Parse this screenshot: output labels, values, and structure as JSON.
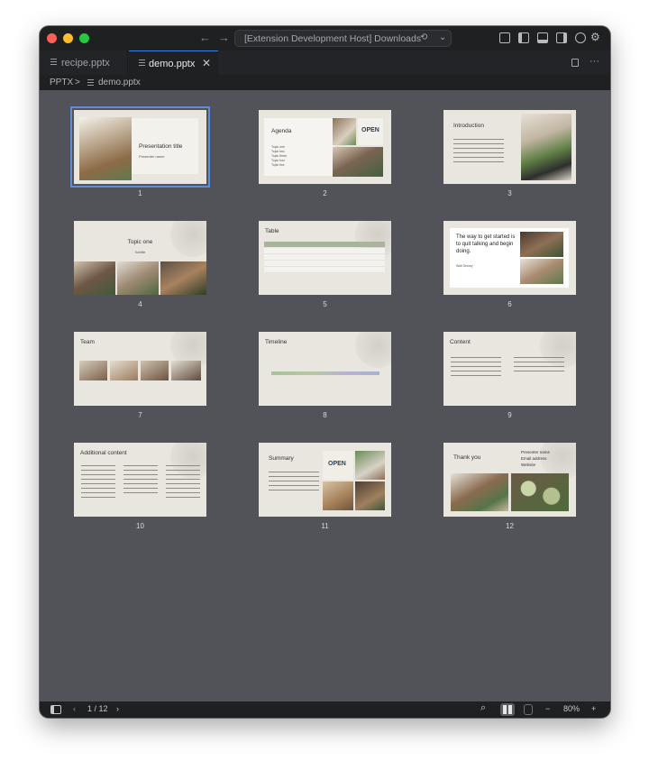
{
  "window": {
    "command_center": "[Extension Development Host] Downloads"
  },
  "tabs": [
    {
      "label": "recipe.pptx"
    },
    {
      "label": "demo.pptx"
    }
  ],
  "breadcrumb": {
    "root": "PPTX",
    "separator": ">",
    "file": "demo.pptx"
  },
  "slides": [
    {
      "number": "1",
      "title": "Presentation title",
      "subtitle": "Presenter name"
    },
    {
      "number": "2",
      "title": "Agenda",
      "items": [
        "Topic one",
        "Topic two",
        "Topic three",
        "Topic four",
        "Topic five"
      ],
      "sign": "OPEN"
    },
    {
      "number": "3",
      "title": "Introduction"
    },
    {
      "number": "4",
      "title": "Topic one",
      "subtitle": "Subtitle"
    },
    {
      "number": "5",
      "title": "Table"
    },
    {
      "number": "6",
      "quote": "The way to get started is to quit talking and begin doing.",
      "author": "Walt Disney"
    },
    {
      "number": "7",
      "title": "Team"
    },
    {
      "number": "8",
      "title": "Timeline"
    },
    {
      "number": "9",
      "title": "Content"
    },
    {
      "number": "10",
      "title": "Additional content"
    },
    {
      "number": "11",
      "title": "Summary",
      "sign": "OPEN"
    },
    {
      "number": "12",
      "title": "Thank you",
      "contacts": [
        "Presenter name",
        "Email address",
        "Website"
      ]
    }
  ],
  "status": {
    "page": "1 / 12",
    "zoom": "80%",
    "zoom_out": "−",
    "zoom_in": "+",
    "prev": "‹",
    "next": "›"
  },
  "colors": {
    "selection": "#5b8dde",
    "canvas": "#515358",
    "slide_bg": "#e9e6e0"
  }
}
